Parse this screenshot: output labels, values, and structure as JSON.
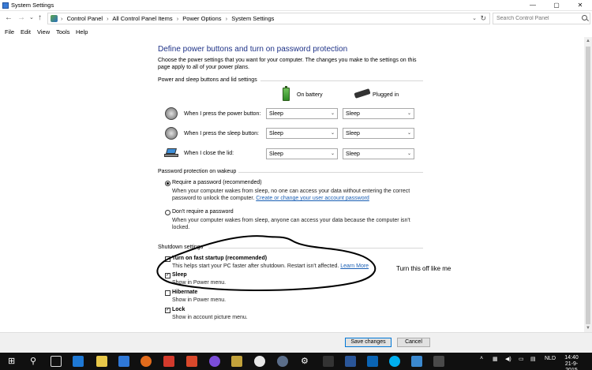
{
  "window": {
    "title": "System Settings",
    "controls": [
      "—",
      "▢",
      "✕"
    ]
  },
  "nav": {
    "back": "←",
    "forward": "→",
    "recent": "⌄",
    "up": "↑",
    "breadcrumbs": [
      "Control Panel",
      "All Control Panel Items",
      "Power Options",
      "System Settings"
    ],
    "separator": "›",
    "dropdown": "⌄",
    "refresh": "↻",
    "search_placeholder": "Search Control Panel"
  },
  "menu": [
    "File",
    "Edit",
    "View",
    "Tools",
    "Help"
  ],
  "page": {
    "heading": "Define power buttons and turn on password protection",
    "intro": "Choose the power settings that you want for your computer. The changes you make to the settings on this page apply to all of your power plans."
  },
  "power_buttons": {
    "group_title": "Power and sleep buttons and lid settings",
    "col_battery": "On battery",
    "col_plugged": "Plugged in",
    "rows": [
      {
        "label": "When I press the power button:",
        "battery": "Sleep",
        "plugged": "Sleep"
      },
      {
        "label": "When I press the sleep button:",
        "battery": "Sleep",
        "plugged": "Sleep"
      },
      {
        "label": "When I close the lid:",
        "battery": "Sleep",
        "plugged": "Sleep"
      }
    ]
  },
  "password": {
    "group_title": "Password protection on wakeup",
    "require_label": "Require a password (recommended)",
    "require_desc": "When your computer wakes from sleep, no one can access your data without entering the correct password to unlock the computer.",
    "require_link": "Create or change your user account password",
    "norequire_label": "Don't require a password",
    "norequire_desc": "When your computer wakes from sleep, anyone can access your data because the computer isn't locked.",
    "selected": "require"
  },
  "shutdown": {
    "group_title": "Shutdown settings",
    "items": [
      {
        "label": "Turn on fast startup (recommended)",
        "desc": "This helps start your PC faster after shutdown. Restart isn't affected.",
        "link": "Learn More",
        "checked": false
      },
      {
        "label": "Sleep",
        "desc": "Show in Power menu.",
        "checked": true
      },
      {
        "label": "Hibernate",
        "desc": "Show in Power menu.",
        "checked": false
      },
      {
        "label": "Lock",
        "desc": "Show in account picture menu.",
        "checked": true
      }
    ],
    "check_mark": "✓"
  },
  "annotation": "Turn this off like me",
  "buttons": {
    "save": "Save changes",
    "cancel": "Cancel"
  },
  "taskbar": {
    "search_glyph": "⚲",
    "language": "NLD",
    "time": "14:40",
    "date": "21-9-2015"
  },
  "colors": {
    "heading": "#1e3287",
    "link": "#1a5fb4",
    "taskbar": "#101010"
  }
}
